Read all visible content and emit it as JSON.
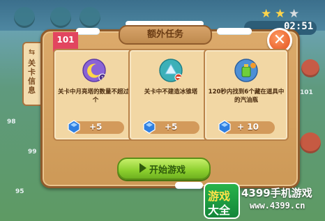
{
  "dialog": {
    "title": "额外任务",
    "level_badge": "101",
    "side_tab": {
      "arrow": "⇆",
      "label": "关卡信息"
    },
    "close_glyph": "✕",
    "start_button": "开始游戏"
  },
  "tasks": [
    {
      "text": "关卡中月亮塔的数量不超过1个",
      "reward": "+5",
      "icon": "moon-tower-icon"
    },
    {
      "text": "关卡中不建造冰锥塔",
      "reward": "+5",
      "icon": "ice-tower-icon"
    },
    {
      "text": "120秒内找到6个藏在道具中的汽油瓶",
      "reward": "+ 10",
      "icon": "gas-bottle-icon"
    }
  ],
  "background": {
    "timer": "02:51",
    "stars_filled": 2,
    "level_numbers": [
      "98",
      "99",
      "101",
      "95"
    ]
  },
  "watermark": {
    "logo_line1": "游戏",
    "logo_line2": "大全",
    "brand": "4399手机游戏",
    "url": "www.4399.cn"
  },
  "colors": {
    "panel": "#d8a465",
    "reward_gem": "#2f7fe0",
    "start_button": "#9ad93a",
    "close_button": "#f06a2b",
    "badge": "#e2455f"
  }
}
